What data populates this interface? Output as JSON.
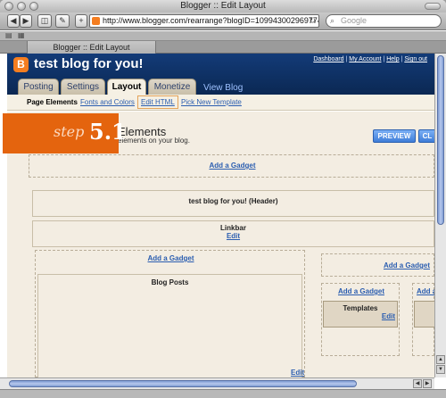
{
  "window": {
    "title": "Blogger :: Edit Layout",
    "url": "http://www.blogger.com/rearrange?blogID=1099430029697742390",
    "search_placeholder": "Google",
    "browser_tab": "Blogger :: Edit Layout"
  },
  "blog": {
    "title": "test blog for you!",
    "links": {
      "dashboard": "Dashboard",
      "my_account": "My Account",
      "help": "Help",
      "sign_out": "Sign out"
    }
  },
  "tabs": [
    "Posting",
    "Settings",
    "Layout",
    "Monetize"
  ],
  "view_blog": "View Blog",
  "subnav": [
    "Page Elements",
    "Fonts and Colors",
    "Edit HTML",
    "Pick New Template"
  ],
  "step": {
    "word": "step",
    "number": "5.1"
  },
  "page": {
    "heading": "Elements",
    "subheading": "elements on your blog.",
    "preview": "PREVIEW",
    "clear": "CL"
  },
  "layout": {
    "add_gadget": "Add a Gadget",
    "header_widget": "test blog for you! (Header)",
    "linkbar": "Linkbar",
    "edit": "Edit",
    "blog_posts": "Blog Posts",
    "templates": "Templates"
  }
}
